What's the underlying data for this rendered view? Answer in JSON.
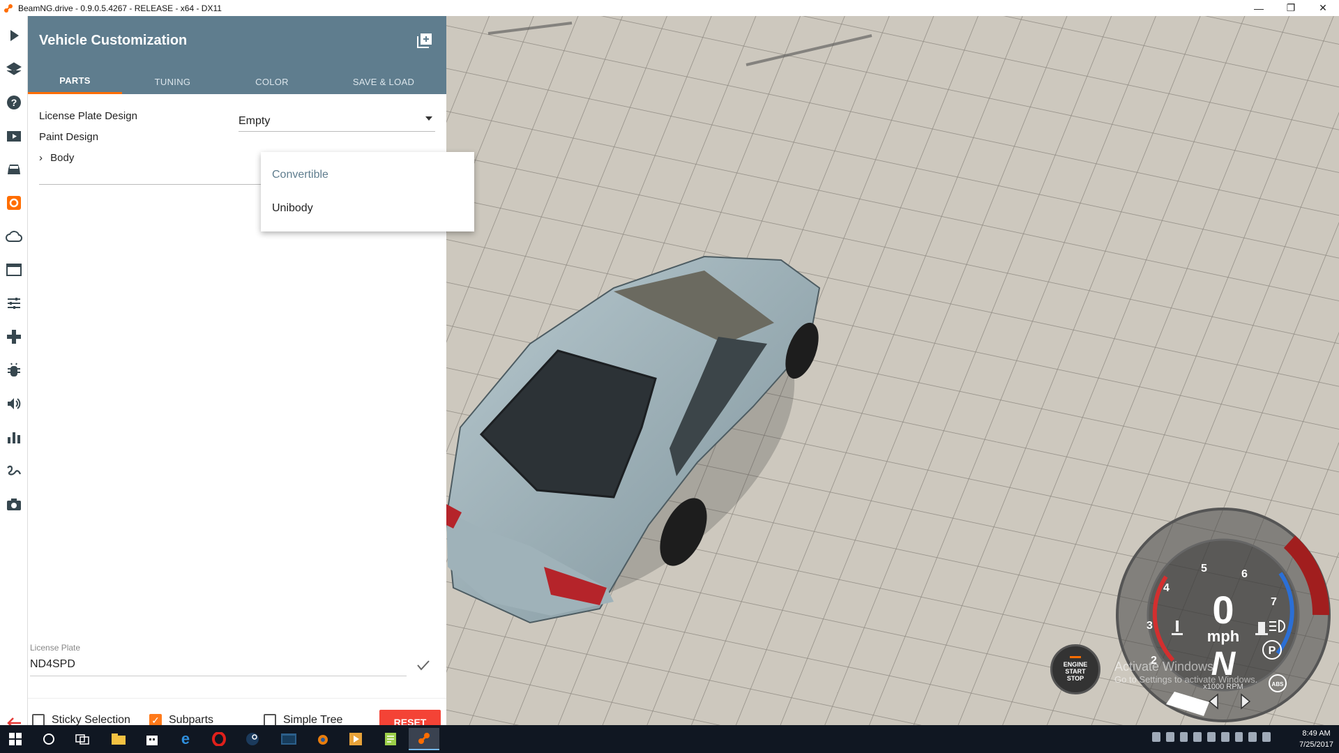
{
  "window": {
    "title": "BeamNG.drive - 0.9.0.5.4267 - RELEASE - x64 - DX11"
  },
  "sidebar": {
    "icons": [
      "play-icon",
      "layers-icon",
      "help-icon",
      "video-icon",
      "car-icon",
      "vehicle-config-icon",
      "cloud-icon",
      "window-icon",
      "sliders-icon",
      "gamepad-icon",
      "bug-icon",
      "volume-icon",
      "bar-chart-icon",
      "gesture-icon",
      "camera-icon"
    ],
    "active": "vehicle-config-icon",
    "accent": "#ff6d00"
  },
  "panel": {
    "title": "Vehicle Customization",
    "header_color": "#5f7d8e",
    "tabs": [
      {
        "label": "PARTS",
        "active": true
      },
      {
        "label": "TUNING",
        "active": false
      },
      {
        "label": "COLOR",
        "active": false
      },
      {
        "label": "SAVE & LOAD",
        "active": false
      }
    ],
    "parts": {
      "license_plate_design_label": "License Plate Design",
      "license_plate_design_value": "Empty",
      "paint_design_label": "Paint Design",
      "body_label": "Body"
    },
    "dropdown": {
      "options": [
        "Convertible",
        "Unibody"
      ]
    },
    "license_plate": {
      "label": "License Plate",
      "value": "ND4SPD"
    },
    "footer": {
      "sticky_selection": {
        "label": "Sticky Selection",
        "checked": false
      },
      "subparts": {
        "label": "Subparts",
        "checked": true
      },
      "simple_tree": {
        "label": "Simple Tree",
        "checked": false
      },
      "reset_label": "RESET"
    }
  },
  "hud": {
    "engine_button": {
      "line1": "ENGINE",
      "line2": "START",
      "line3": "STOP"
    },
    "speed": "0",
    "speed_unit": "mph",
    "gear": "N",
    "rpm_label": "x1000 RPM",
    "tach_marks": [
      "2",
      "3",
      "4",
      "5",
      "6",
      "7"
    ],
    "parking_brake": "P",
    "abs": "ABS"
  },
  "watermark": {
    "line1": "Activate Windows",
    "line2": "Go to Settings to activate Windows."
  },
  "taskbar": {
    "time": "8:49 AM",
    "date": "7/25/2017"
  }
}
